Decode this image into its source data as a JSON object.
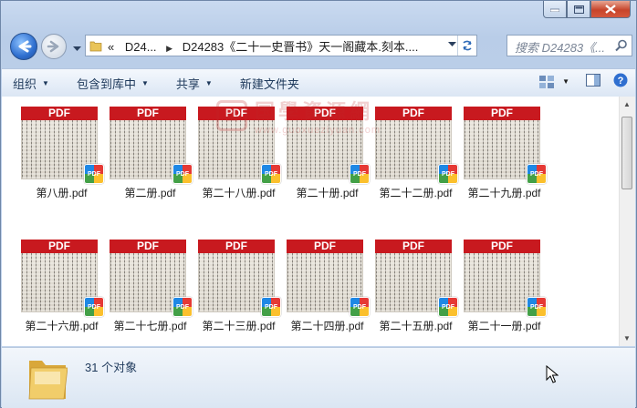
{
  "window": {
    "minimize_icon": "minimize-icon",
    "maximize_icon": "maximize-icon",
    "close_icon": "close-icon"
  },
  "nav": {
    "back_icon": "back-arrow-icon",
    "forward_icon": "forward-arrow-icon"
  },
  "address": {
    "overflow": "«",
    "crumbs": [
      "D24...",
      "D24283《二十一史晋书》天一阁藏本.刻本...."
    ],
    "refresh_icon": "refresh-icon"
  },
  "search": {
    "placeholder": "搜索 D24283《..."
  },
  "toolbar": {
    "organize": "组织",
    "include_in_library": "包含到库中",
    "share": "共享",
    "new_folder": "新建文件夹"
  },
  "files": [
    {
      "name": "第八册.pdf"
    },
    {
      "name": "第二册.pdf"
    },
    {
      "name": "第二十八册.pdf"
    },
    {
      "name": "第二十册.pdf"
    },
    {
      "name": "第二十二册.pdf"
    },
    {
      "name": "第二十九册.pdf"
    },
    {
      "name": "第二十六册.pdf"
    },
    {
      "name": "第二十七册.pdf"
    },
    {
      "name": "第二十三册.pdf"
    },
    {
      "name": "第二十四册.pdf"
    },
    {
      "name": "第二十五册.pdf"
    },
    {
      "name": "第二十一册.pdf"
    }
  ],
  "thumb_label": "PDF",
  "badge_label": "PDF",
  "watermark": {
    "seal": "國",
    "cn": "国學資源網",
    "url": "www.guoxueziyuan.com"
  },
  "status": {
    "count": "31 个对象"
  },
  "colors": {
    "pdf_red": "#c8191f",
    "toolbar_text": "#1e395b"
  }
}
